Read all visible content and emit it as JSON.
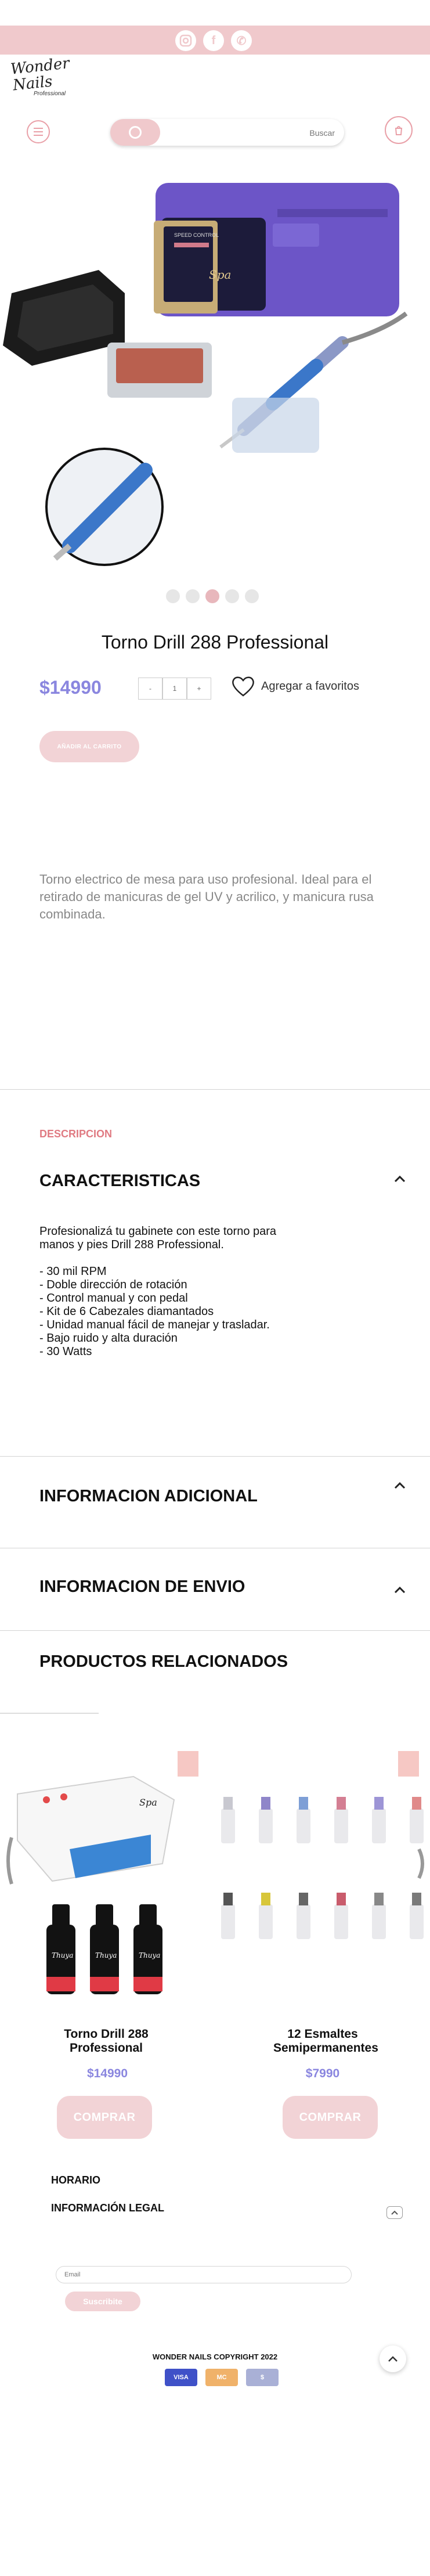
{
  "header": {
    "social": [
      {
        "icon": "instagram-icon",
        "glyph": "◎"
      },
      {
        "icon": "facebook-icon",
        "glyph": "f"
      },
      {
        "icon": "whatsapp-icon",
        "glyph": "✆"
      }
    ],
    "logo": {
      "line1": "Wonder",
      "line2": "Nails",
      "tagline": "Professional"
    },
    "search": {
      "placeholder": "Buscar"
    }
  },
  "product": {
    "title": "Torno Drill 288 Professional",
    "price": "$14990",
    "quantity": {
      "minus": "-",
      "value": "1",
      "plus": "+"
    },
    "favorite_label": "Agregar a favoritos",
    "add_to_cart_label": "AÑADIR AL CARRITO",
    "gallery_dots": 5,
    "gallery_active": 2,
    "device_brand_text": "Spa",
    "device_panel_text": "SPEED CONTROL",
    "description": "Torno electrico de mesa para uso profesional. Ideal para el retirado de manicuras de gel UV y acrilico, y manicura rusa combinada."
  },
  "details": {
    "tab_label": "DESCRIPCION",
    "characteristics_title": "CARACTERISTICAS",
    "characteristics_body": "Profesionalizá tu gabinete con este torno para manos y pies Drill 288 Professional.\n\n- 30 mil RPM\n- Doble dirección de rotación\n- Control manual y con pedal\n- Kit de 6 Cabezales diamantados\n- Unidad manual fácil de manejar y trasladar.\n- Bajo ruido y alta duración\n- 30 Watts",
    "additional_title": "INFORMACION ADICIONAL",
    "shipping_title": "INFORMACION DE ENVIO"
  },
  "related": {
    "title": "PRODUCTOS RELACIONADOS",
    "items": [
      {
        "name": "Torno Drill 288 Professional",
        "price": "$14990",
        "button": "COMPRAR",
        "lamp_brand": "Spa",
        "bottle_brand": "Thuya"
      },
      {
        "name": "12 Esmaltes Semipermanentes",
        "price": "$7990",
        "button": "COMPRAR"
      }
    ]
  },
  "footer": {
    "hours": "HORARIO",
    "legal": "INFORMACIÓN LEGAL",
    "email_placeholder": "Email",
    "subscribe": "Suscribite",
    "copyright": "WONDER NAILS  COPYRIGHT 2022",
    "payments": [
      {
        "label": "VISA",
        "color": "#3f51c8"
      },
      {
        "label": "MC",
        "color": "#f0b26a"
      },
      {
        "label": "$",
        "color": "#a9b0d6"
      }
    ]
  },
  "colors": {
    "accent_pink": "#f0c9cc",
    "price_purple": "#8a86df",
    "label_red": "#e07a82"
  }
}
